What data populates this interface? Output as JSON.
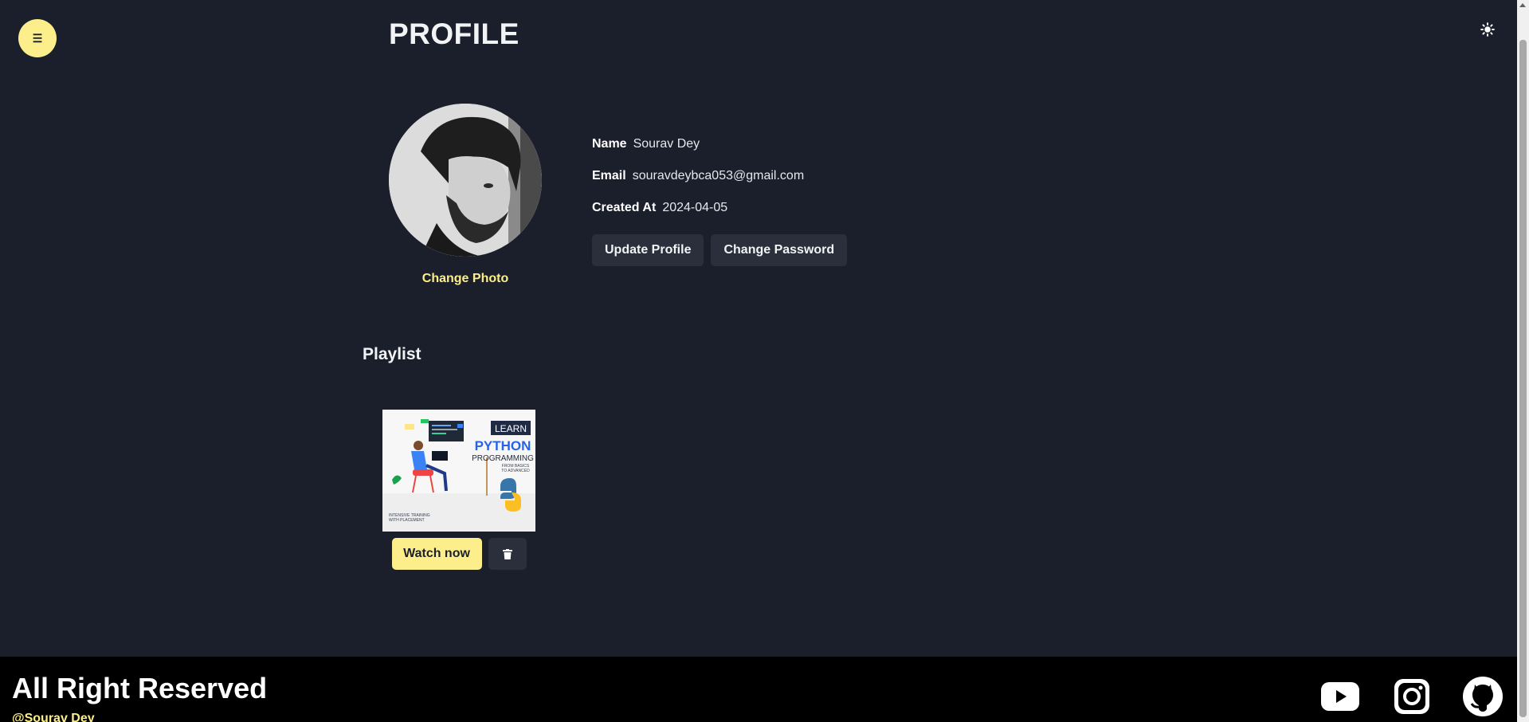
{
  "header": {
    "menu_icon": "hamburger-icon",
    "menu_glyph": "☰",
    "theme_icon": "sun-icon",
    "title": "PROFILE"
  },
  "profile": {
    "avatar_alt": "profile photo",
    "change_photo_label": "Change Photo",
    "fields": [
      {
        "key": "Name",
        "value": "Sourav Dey"
      },
      {
        "key": "Email",
        "value": "souravdeybca053@gmail.com"
      },
      {
        "key": "Created At",
        "value": "2024-04-05"
      }
    ],
    "update_label": "Update Profile",
    "change_password_label": "Change Password"
  },
  "playlist": {
    "title": "Playlist",
    "items": [
      {
        "thumb": {
          "tag": "LEARN",
          "title": "PYTHON",
          "subtitle": "PROGRAMMING",
          "small_line1": "FROM BASICS",
          "small_line2": "TO ADVANCED",
          "bottom_line1": "INTENSIVE TRAINING",
          "bottom_line2": "WITH PLACEMENT"
        },
        "watch_label": "Watch now",
        "delete_icon": "trash-icon"
      }
    ]
  },
  "footer": {
    "title": "All Right Reserved",
    "handle": "@Sourav Dey",
    "social": [
      "youtube-icon",
      "instagram-icon",
      "github-icon"
    ]
  },
  "colors": {
    "background": "#1b1f2b",
    "accent": "#fcef8b",
    "button_dark": "#2b2f3b",
    "footer": "#000000"
  }
}
